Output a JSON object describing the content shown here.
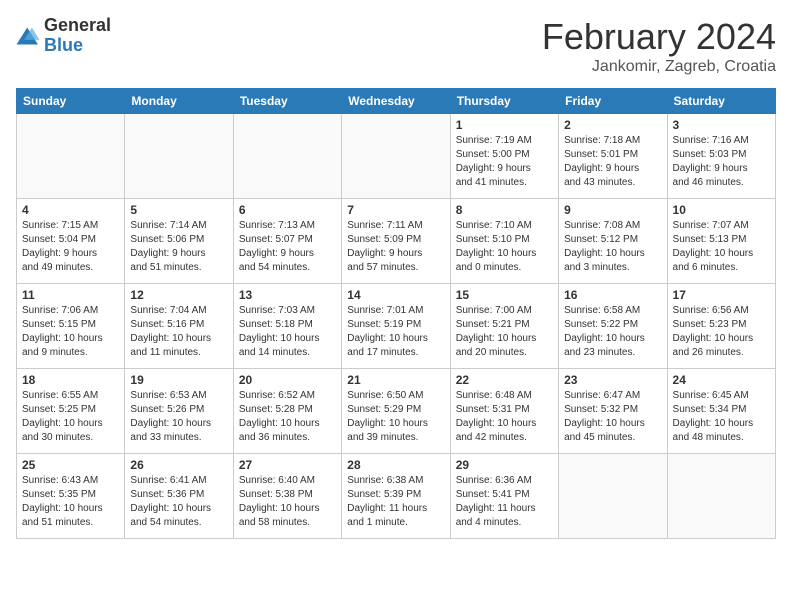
{
  "header": {
    "logo_general": "General",
    "logo_blue": "Blue",
    "month_year": "February 2024",
    "location": "Jankomir, Zagreb, Croatia"
  },
  "weekdays": [
    "Sunday",
    "Monday",
    "Tuesday",
    "Wednesday",
    "Thursday",
    "Friday",
    "Saturday"
  ],
  "weeks": [
    [
      {
        "day": "",
        "detail": ""
      },
      {
        "day": "",
        "detail": ""
      },
      {
        "day": "",
        "detail": ""
      },
      {
        "day": "",
        "detail": ""
      },
      {
        "day": "1",
        "detail": "Sunrise: 7:19 AM\nSunset: 5:00 PM\nDaylight: 9 hours\nand 41 minutes."
      },
      {
        "day": "2",
        "detail": "Sunrise: 7:18 AM\nSunset: 5:01 PM\nDaylight: 9 hours\nand 43 minutes."
      },
      {
        "day": "3",
        "detail": "Sunrise: 7:16 AM\nSunset: 5:03 PM\nDaylight: 9 hours\nand 46 minutes."
      }
    ],
    [
      {
        "day": "4",
        "detail": "Sunrise: 7:15 AM\nSunset: 5:04 PM\nDaylight: 9 hours\nand 49 minutes."
      },
      {
        "day": "5",
        "detail": "Sunrise: 7:14 AM\nSunset: 5:06 PM\nDaylight: 9 hours\nand 51 minutes."
      },
      {
        "day": "6",
        "detail": "Sunrise: 7:13 AM\nSunset: 5:07 PM\nDaylight: 9 hours\nand 54 minutes."
      },
      {
        "day": "7",
        "detail": "Sunrise: 7:11 AM\nSunset: 5:09 PM\nDaylight: 9 hours\nand 57 minutes."
      },
      {
        "day": "8",
        "detail": "Sunrise: 7:10 AM\nSunset: 5:10 PM\nDaylight: 10 hours\nand 0 minutes."
      },
      {
        "day": "9",
        "detail": "Sunrise: 7:08 AM\nSunset: 5:12 PM\nDaylight: 10 hours\nand 3 minutes."
      },
      {
        "day": "10",
        "detail": "Sunrise: 7:07 AM\nSunset: 5:13 PM\nDaylight: 10 hours\nand 6 minutes."
      }
    ],
    [
      {
        "day": "11",
        "detail": "Sunrise: 7:06 AM\nSunset: 5:15 PM\nDaylight: 10 hours\nand 9 minutes."
      },
      {
        "day": "12",
        "detail": "Sunrise: 7:04 AM\nSunset: 5:16 PM\nDaylight: 10 hours\nand 11 minutes."
      },
      {
        "day": "13",
        "detail": "Sunrise: 7:03 AM\nSunset: 5:18 PM\nDaylight: 10 hours\nand 14 minutes."
      },
      {
        "day": "14",
        "detail": "Sunrise: 7:01 AM\nSunset: 5:19 PM\nDaylight: 10 hours\nand 17 minutes."
      },
      {
        "day": "15",
        "detail": "Sunrise: 7:00 AM\nSunset: 5:21 PM\nDaylight: 10 hours\nand 20 minutes."
      },
      {
        "day": "16",
        "detail": "Sunrise: 6:58 AM\nSunset: 5:22 PM\nDaylight: 10 hours\nand 23 minutes."
      },
      {
        "day": "17",
        "detail": "Sunrise: 6:56 AM\nSunset: 5:23 PM\nDaylight: 10 hours\nand 26 minutes."
      }
    ],
    [
      {
        "day": "18",
        "detail": "Sunrise: 6:55 AM\nSunset: 5:25 PM\nDaylight: 10 hours\nand 30 minutes."
      },
      {
        "day": "19",
        "detail": "Sunrise: 6:53 AM\nSunset: 5:26 PM\nDaylight: 10 hours\nand 33 minutes."
      },
      {
        "day": "20",
        "detail": "Sunrise: 6:52 AM\nSunset: 5:28 PM\nDaylight: 10 hours\nand 36 minutes."
      },
      {
        "day": "21",
        "detail": "Sunrise: 6:50 AM\nSunset: 5:29 PM\nDaylight: 10 hours\nand 39 minutes."
      },
      {
        "day": "22",
        "detail": "Sunrise: 6:48 AM\nSunset: 5:31 PM\nDaylight: 10 hours\nand 42 minutes."
      },
      {
        "day": "23",
        "detail": "Sunrise: 6:47 AM\nSunset: 5:32 PM\nDaylight: 10 hours\nand 45 minutes."
      },
      {
        "day": "24",
        "detail": "Sunrise: 6:45 AM\nSunset: 5:34 PM\nDaylight: 10 hours\nand 48 minutes."
      }
    ],
    [
      {
        "day": "25",
        "detail": "Sunrise: 6:43 AM\nSunset: 5:35 PM\nDaylight: 10 hours\nand 51 minutes."
      },
      {
        "day": "26",
        "detail": "Sunrise: 6:41 AM\nSunset: 5:36 PM\nDaylight: 10 hours\nand 54 minutes."
      },
      {
        "day": "27",
        "detail": "Sunrise: 6:40 AM\nSunset: 5:38 PM\nDaylight: 10 hours\nand 58 minutes."
      },
      {
        "day": "28",
        "detail": "Sunrise: 6:38 AM\nSunset: 5:39 PM\nDaylight: 11 hours\nand 1 minute."
      },
      {
        "day": "29",
        "detail": "Sunrise: 6:36 AM\nSunset: 5:41 PM\nDaylight: 11 hours\nand 4 minutes."
      },
      {
        "day": "",
        "detail": ""
      },
      {
        "day": "",
        "detail": ""
      }
    ]
  ]
}
